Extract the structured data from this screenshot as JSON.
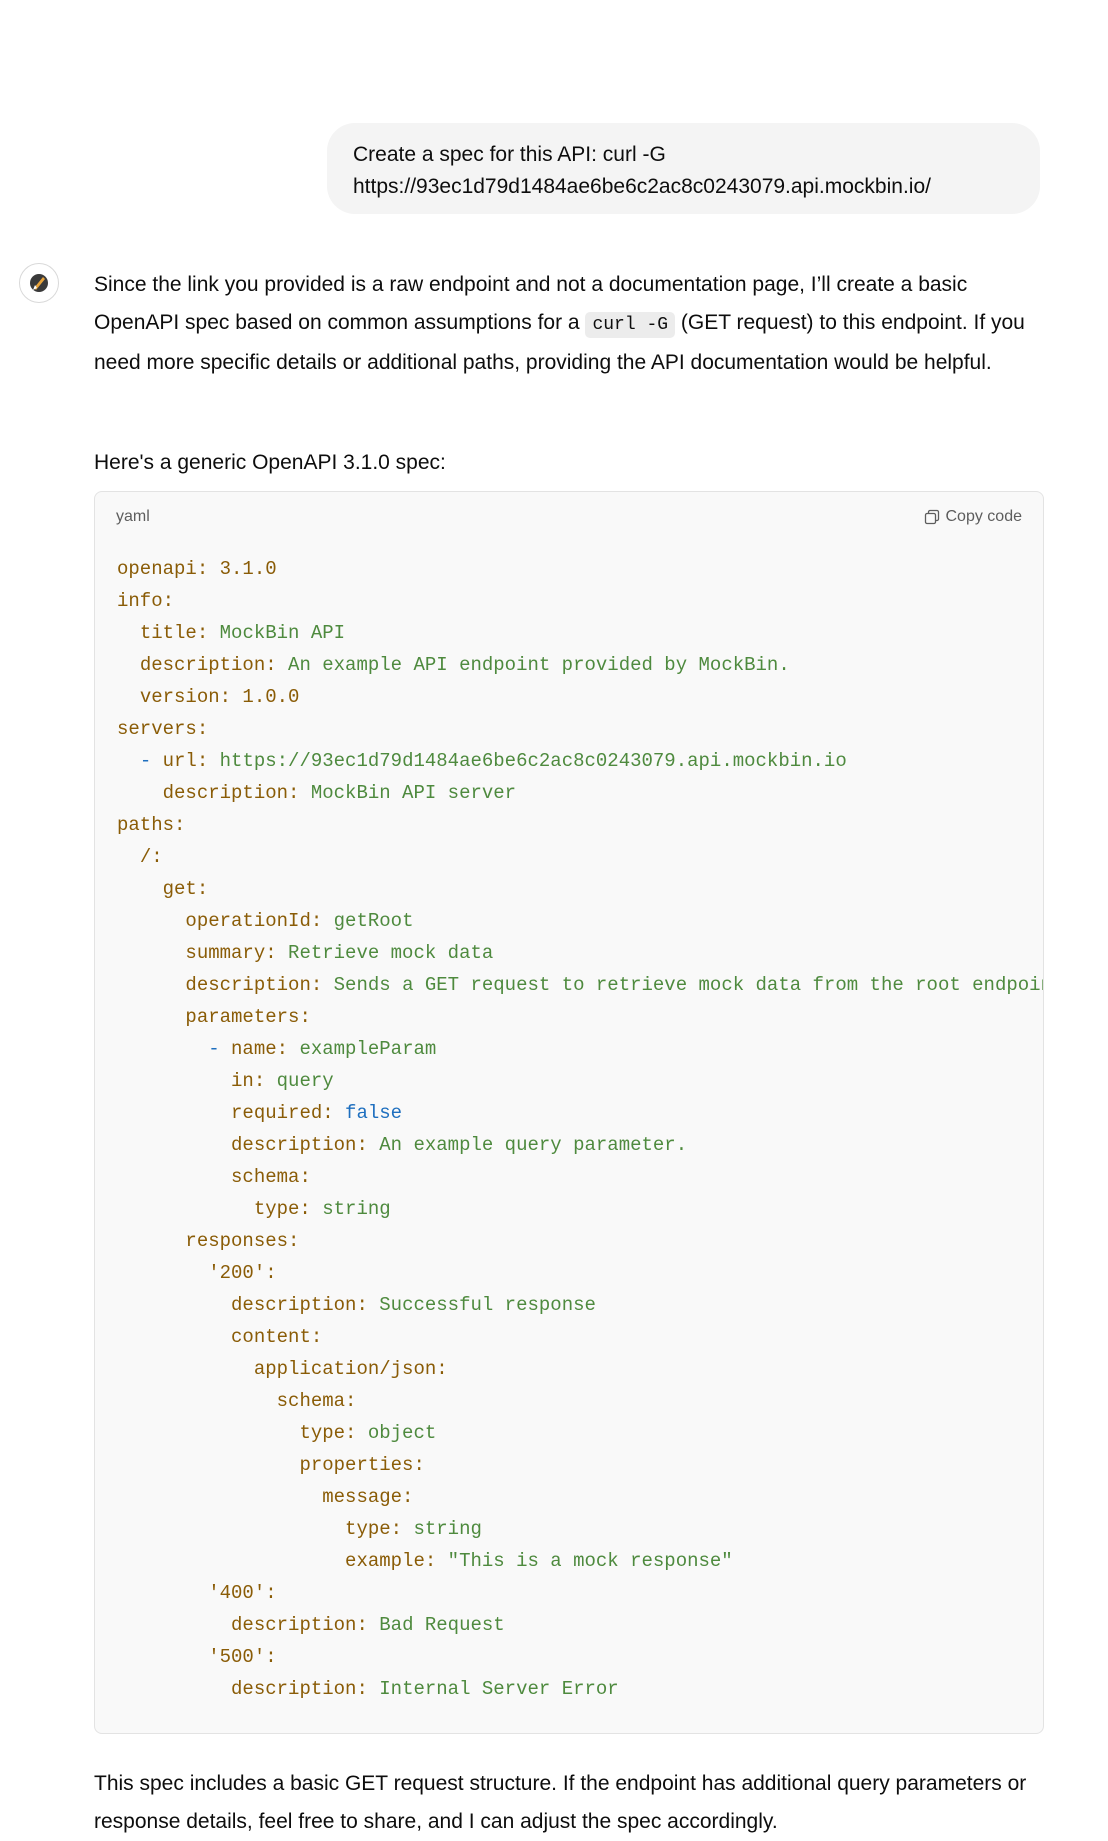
{
  "user_message": {
    "line1": "Create a spec for this API: curl -G",
    "line2": "https://93ec1d79d1484ae6be6c2ac8c0243079.api.mockbin.io/"
  },
  "assistant": {
    "avatar_icon": "gpt-avatar-icon",
    "para1_before": "Since the link you provided is a raw endpoint and not a documentation page, I’ll create a basic OpenAPI spec based on common assumptions for a ",
    "para1_code": "curl -G",
    "para1_after": " (GET request) to this endpoint. If you need more specific details or additional paths, providing the API documentation would be helpful.",
    "intro": "Here's a generic OpenAPI 3.1.0 spec:",
    "code_block": {
      "language": "yaml",
      "copy_label": "Copy code",
      "lines": [
        "openapi: 3.1.0",
        "info:",
        "  title: MockBin API",
        "  description: An example API endpoint provided by MockBin.",
        "  version: 1.0.0",
        "servers:",
        "  - url: https://93ec1d79d1484ae6be6c2ac8c0243079.api.mockbin.io",
        "    description: MockBin API server",
        "paths:",
        "  /:",
        "    get:",
        "      operationId: getRoot",
        "      summary: Retrieve mock data",
        "      description: Sends a GET request to retrieve mock data from the root endpoint.",
        "      parameters:",
        "        - name: exampleParam",
        "          in: query",
        "          required: false",
        "          description: An example query parameter.",
        "          schema:",
        "            type: string",
        "      responses:",
        "        '200':",
        "          description: Successful response",
        "          content:",
        "            application/json:",
        "              schema:",
        "                type: object",
        "                properties:",
        "                  message:",
        "                    type: string",
        "                    example: \"This is a mock response\"",
        "        '400':",
        "          description: Bad Request",
        "        '500':",
        "          description: Internal Server Error"
      ]
    },
    "closing": "This spec includes a basic GET request structure. If the endpoint has additional query parameters or response details, feel free to share, and I can adjust the spec accordingly."
  },
  "colors": {
    "yaml_key": "#8a5c07",
    "yaml_value": "#4e8a3e",
    "yaml_bool": "#1e6fbf",
    "bubble_bg": "#f4f4f4",
    "code_bg": "#f9f9f9"
  }
}
